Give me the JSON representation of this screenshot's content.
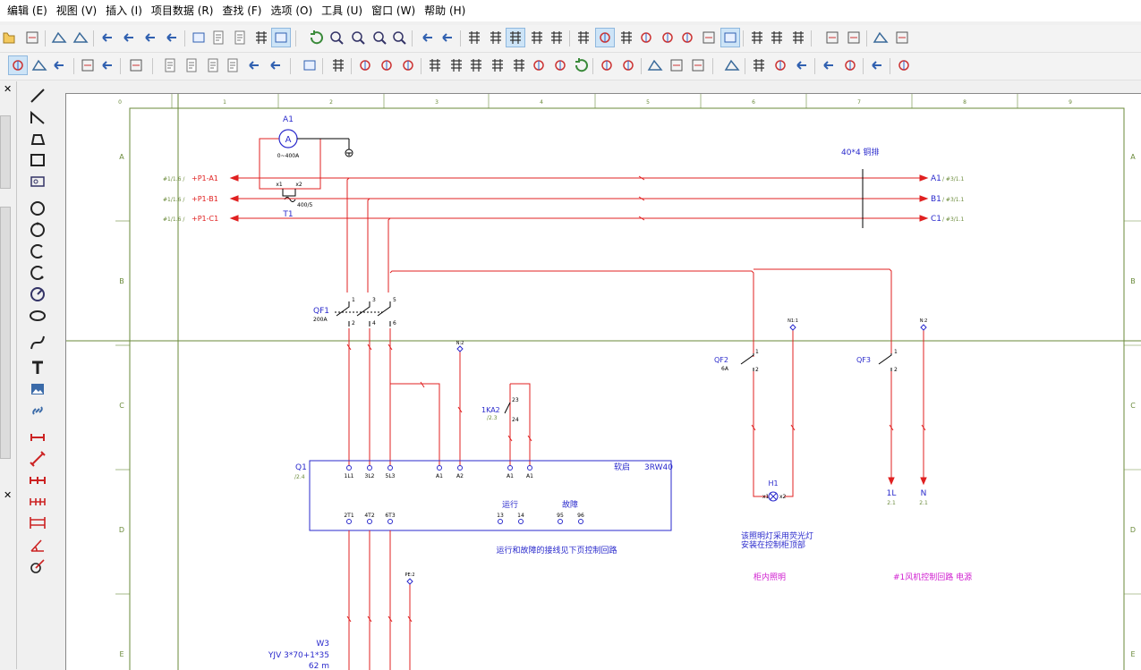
{
  "menu": {
    "items": [
      {
        "id": "edit",
        "label": "编辑 (E)"
      },
      {
        "id": "view",
        "label": "视图 (V)"
      },
      {
        "id": "insert",
        "label": "插入 (I)"
      },
      {
        "id": "project_data",
        "label": "项目数据 (R)"
      },
      {
        "id": "find",
        "label": "查找 (F)"
      },
      {
        "id": "options",
        "label": "选项 (O)"
      },
      {
        "id": "tools",
        "label": "工具 (U)"
      },
      {
        "id": "window",
        "label": "窗口 (W)"
      },
      {
        "id": "help",
        "label": "帮助 (H)"
      }
    ]
  },
  "colors": {
    "wire": "#e02020",
    "designation": "#2a2acc",
    "grid": "#5a9a3a",
    "note": "#d020d0"
  },
  "grid": {
    "columns": [
      "0",
      "1",
      "2",
      "3",
      "4",
      "5",
      "6",
      "7",
      "8",
      "9"
    ],
    "rows": [
      "A",
      "B",
      "C",
      "D",
      "E"
    ]
  },
  "schematic": {
    "ammeter": {
      "name": "A1",
      "symbol": "A",
      "range": "0~400A",
      "terminal_left": "x1",
      "terminal_right": "x2"
    },
    "ct": {
      "name": "T1",
      "ratio": "400/5"
    },
    "incoming": [
      {
        "ref": "#1/1.6 /",
        "label": "+P1-A1"
      },
      {
        "ref": "#1/1.6 /",
        "label": "+P1-B1"
      },
      {
        "ref": "#1/1.6 /",
        "label": "+P1-C1"
      }
    ],
    "busbar": "40*4 铜排",
    "outgoing": [
      {
        "label": "A1",
        "ref": "/ #3/1.1"
      },
      {
        "label": "B1",
        "ref": "/ #3/1.1"
      },
      {
        "label": "C1",
        "ref": "/ #3/1.1"
      }
    ],
    "qf1": {
      "name": "QF1",
      "rating": "200A",
      "top_pins": [
        "1",
        "3",
        "5"
      ],
      "bottom_pins": [
        "2",
        "4",
        "6"
      ]
    },
    "qf2": {
      "name": "QF2",
      "rating": "6A",
      "pin_top": "1",
      "pin_bottom": "2"
    },
    "qf3": {
      "name": "QF3",
      "pin_top": "1",
      "pin_bottom": "2"
    },
    "n_terms": {
      "n1": "N1:1",
      "n2": "N:2",
      "n3": "N:2",
      "pe": "PE:2"
    },
    "relay": {
      "name": "1KA2",
      "ref": "/2.3",
      "pin_a": "23",
      "pin_b": "24"
    },
    "softstarter": {
      "name": "Q1",
      "ref": "/2.4",
      "type_label": "软启",
      "model": "3RW40",
      "input_pins": [
        "1L1",
        "3L2",
        "5L3",
        "A1",
        "A2",
        "A1",
        "A1"
      ],
      "output_pins": [
        "2T1",
        "4T2",
        "6T3"
      ],
      "run_label": "运行",
      "run_pins": [
        "13",
        "14"
      ],
      "fault_label": "故障",
      "fault_pins": [
        "95",
        "96"
      ],
      "note": "运行和故障的接线见下页控制回路"
    },
    "lamp": {
      "name": "H1",
      "pin_left": "x1",
      "pin_right": "x2"
    },
    "lamp_note_line1": "该照明灯采用荧光灯",
    "lamp_note_line2": "安装在控制柜顶部",
    "out_l": {
      "label": "1L",
      "ref": "2.1"
    },
    "out_n": {
      "label": "N",
      "ref": "2.1"
    },
    "cabinet_lighting": "柜内照明",
    "fan_supply": "#1风机控制回路 电源",
    "cable": {
      "name": "W3",
      "spec": "YJV 3*70+1*35",
      "length": "62 m"
    }
  }
}
